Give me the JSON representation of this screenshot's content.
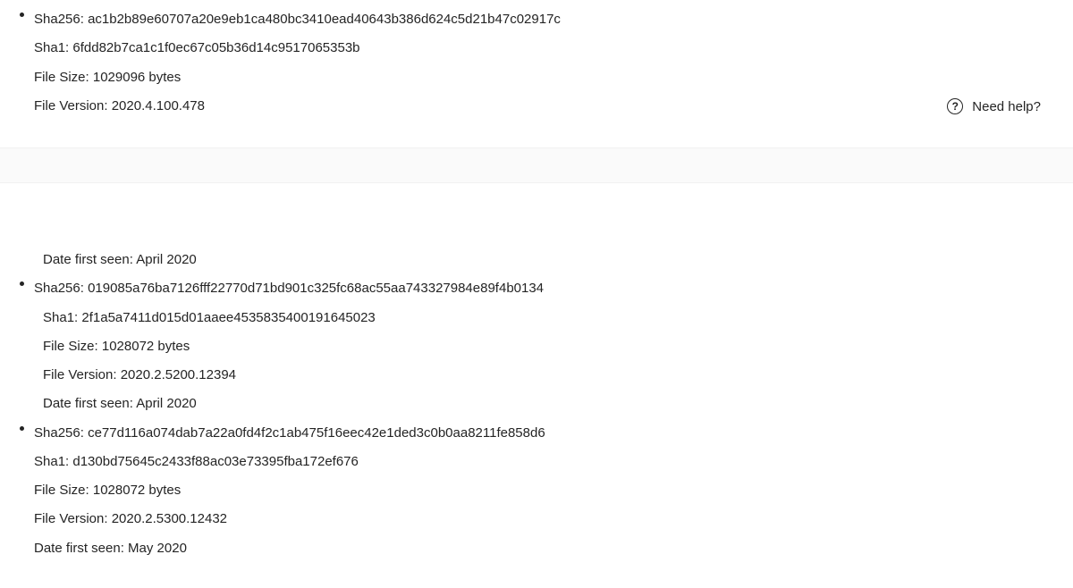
{
  "help": {
    "label": "Need help?"
  },
  "entries": [
    {
      "sha256_label": "Sha256: ",
      "sha256": "ac1b2b89e60707a20e9eb1ca480bc3410ead40643b386d624c5d21b47c02917c",
      "sha1_label": "Sha1: ",
      "sha1": "6fdd82b7ca1c1f0ec67c05b36d14c9517065353b",
      "filesize_label": "File Size: ",
      "filesize": "1029096 bytes",
      "fileversion_label": "File Version: ",
      "fileversion": "2020.4.100.478"
    },
    {
      "datefirst_label": "Date first seen: ",
      "datefirst": "April 2020",
      "sha256_label": "Sha256: ",
      "sha256": "019085a76ba7126fff22770d71bd901c325fc68ac55aa743327984e89f4b0134",
      "sha1_label": "Sha1: ",
      "sha1": "2f1a5a7411d015d01aaee4535835400191645023",
      "filesize_label": "File Size: ",
      "filesize": "1028072 bytes",
      "fileversion_label": "File Version: ",
      "fileversion": "2020.2.5200.12394",
      "datefirst2_label": "Date first seen: ",
      "datefirst2": "April 2020"
    },
    {
      "sha256_label": "Sha256: ",
      "sha256": "ce77d116a074dab7a22a0fd4f2c1ab475f16eec42e1ded3c0b0aa8211fe858d6",
      "sha1_label": "Sha1: ",
      "sha1": "d130bd75645c2433f88ac03e73395fba172ef676",
      "filesize_label": "File Size: ",
      "filesize": "1028072 bytes",
      "fileversion_label": "File Version: ",
      "fileversion": "2020.2.5300.12432",
      "datefirst_label": "Date first seen: ",
      "datefirst": "May 2020"
    }
  ]
}
